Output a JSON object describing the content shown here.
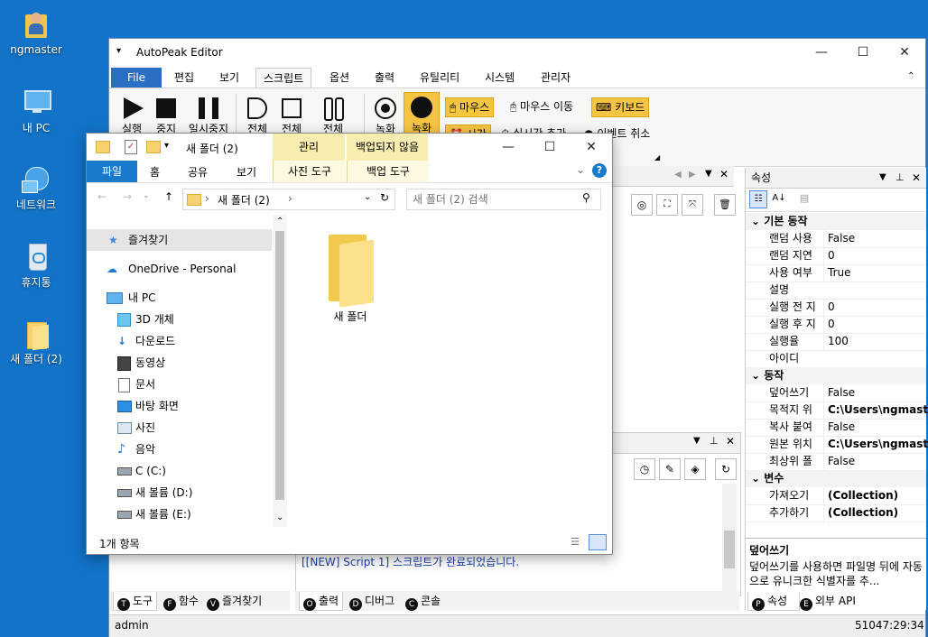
{
  "desktop": {
    "icons": [
      {
        "label": "ngmaster",
        "icon": "user-folder-icon"
      },
      {
        "label": "내 PC",
        "icon": "computer-icon"
      },
      {
        "label": "네트워크",
        "icon": "network-icon"
      },
      {
        "label": "휴지통",
        "icon": "recycle-bin-icon"
      },
      {
        "label": "새 폴더 (2)",
        "icon": "folder-icon"
      }
    ]
  },
  "editor": {
    "title": "AutoPeak Editor",
    "menu": [
      "File",
      "편집",
      "보기",
      "스크립트",
      "옵션",
      "출력",
      "유틸리티",
      "시스템",
      "관리자"
    ],
    "active_menu": "스크립트",
    "ribbon": {
      "run": "실행",
      "stop": "중지",
      "pause": "일시중지",
      "all1": "전체",
      "all2": "전체",
      "all3": "전체",
      "rec": "녹화",
      "rec2": "녹화",
      "mouse": "마우스",
      "mouse_move": "마우스 이동",
      "keyboard": "키보드",
      "time": "시간",
      "realtime_add": "실시간 추가",
      "event_cancel": "이벤트 취소"
    },
    "properties": {
      "header": "속성",
      "categories": [
        {
          "name": "기본 동작",
          "rows": [
            {
              "k": "랜덤 사용",
              "v": "False"
            },
            {
              "k": "랜덤 지연",
              "v": "0"
            },
            {
              "k": "사용 여부",
              "v": "True"
            },
            {
              "k": "설명",
              "v": ""
            },
            {
              "k": "실행 전 지",
              "v": "0"
            },
            {
              "k": "실행 후 지",
              "v": "0"
            },
            {
              "k": "실행율",
              "v": "100"
            },
            {
              "k": "아이디",
              "v": ""
            }
          ]
        },
        {
          "name": "동작",
          "rows": [
            {
              "k": "덮어쓰기",
              "v": "False"
            },
            {
              "k": "목적지 위",
              "v": "C:\\Users\\ngmaste"
            },
            {
              "k": "복사 붙여",
              "v": "False"
            },
            {
              "k": "원본 위치",
              "v": "C:\\Users\\ngmaste"
            },
            {
              "k": "최상위 폴",
              "v": "False"
            }
          ]
        },
        {
          "name": "변수",
          "rows": [
            {
              "k": "가져오기",
              "v": "(Collection)"
            },
            {
              "k": "추가하기",
              "v": "(Collection)"
            }
          ]
        }
      ],
      "desc_title": "덮어쓰기",
      "desc_text": "덮어쓰기를 사용하면 파일명 뒤에 자동으로 유니크한 식별자를 추...",
      "tabs": [
        "속성",
        "외부 API"
      ],
      "tab_keys": [
        "P",
        "E"
      ]
    },
    "output_text": "[[NEW] Script 1] 스크립트가 완료되었습니다.",
    "bottom_tabs_left": [
      {
        "key": "T",
        "label": "도구"
      },
      {
        "key": "F",
        "label": "함수"
      },
      {
        "key": "V",
        "label": "즐겨찾기"
      }
    ],
    "bottom_tabs_mid": [
      {
        "key": "O",
        "label": "출력"
      },
      {
        "key": "D",
        "label": "디버그"
      },
      {
        "key": "C",
        "label": "콘솔"
      }
    ],
    "status_left": "admin",
    "status_right": "51047:29:34"
  },
  "explorer": {
    "title": "새 폴더 (2)",
    "ctx_tab1": "관리",
    "ctx_tab2": "백업되지 않음",
    "ribbon_tabs": [
      "파일",
      "홈",
      "공유",
      "보기",
      "사진 도구",
      "백업 도구"
    ],
    "address": "새 폴더 (2)",
    "search_placeholder": "새 폴더 (2) 검색",
    "nav": [
      {
        "label": "즐겨찾기",
        "icon": "star-icon"
      },
      {
        "label": "OneDrive - Personal",
        "icon": "cloud-icon"
      },
      {
        "label": "내 PC",
        "icon": "computer-icon"
      },
      {
        "label": "3D 개체",
        "icon": "cube-icon"
      },
      {
        "label": "다운로드",
        "icon": "download-icon"
      },
      {
        "label": "동영상",
        "icon": "video-icon"
      },
      {
        "label": "문서",
        "icon": "document-icon"
      },
      {
        "label": "바탕 화면",
        "icon": "desktop-icon"
      },
      {
        "label": "사진",
        "icon": "picture-icon"
      },
      {
        "label": "음악",
        "icon": "music-icon"
      },
      {
        "label": "C (C:)",
        "icon": "drive-icon"
      },
      {
        "label": "새 볼륨 (D:)",
        "icon": "drive-icon"
      },
      {
        "label": "새 볼륨 (E:)",
        "icon": "drive-icon"
      }
    ],
    "item": "새 폴더",
    "status": "1개 항목"
  }
}
